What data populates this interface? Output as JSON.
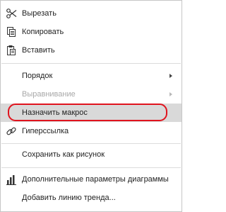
{
  "context_menu": {
    "cut_label": "Вырезать",
    "copy_label": "Копировать",
    "paste_label": "Вставить",
    "order_label": "Порядок",
    "align_label": "Выравнивание",
    "assign_macro_label": "Назначить макрос",
    "hyperlink_label": "Гиперссылка",
    "save_as_image_label": "Сохранить как рисунок",
    "chart_settings_label": "Дополнительные параметры диаграммы",
    "add_trendline_label": "Добавить линию тренда..."
  },
  "icons": {
    "cut": "scissors-icon",
    "copy": "copy-icon",
    "paste": "paste-icon",
    "hyperlink": "link-icon",
    "chart_settings": "bar-chart-icon"
  },
  "colors": {
    "highlight_ring": "#e0141e",
    "hover_background": "#d9d9d9",
    "disabled_text": "#a8a8a8"
  }
}
